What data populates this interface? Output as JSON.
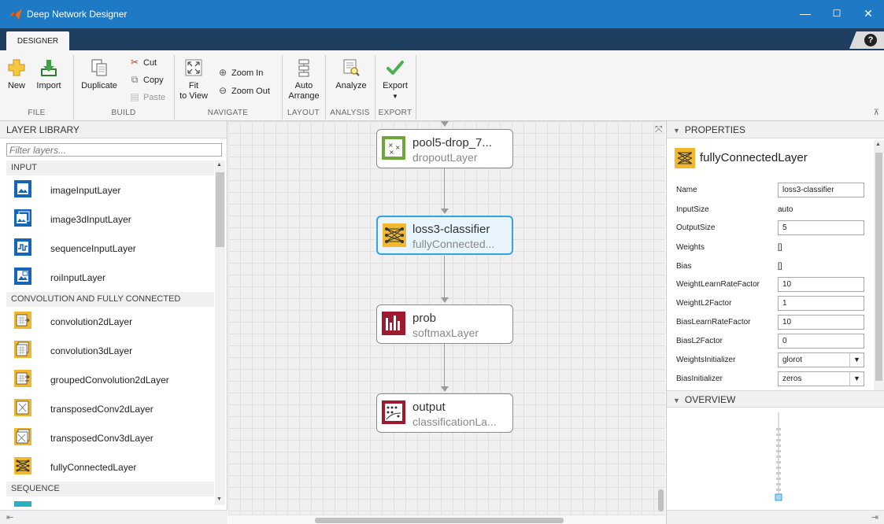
{
  "window": {
    "title": "Deep Network Designer",
    "minimize": "—",
    "maximize": "☐",
    "close": "✕"
  },
  "tabs": {
    "designer": "DESIGNER",
    "help": "?"
  },
  "toolstrip": {
    "new": "New",
    "import": "Import",
    "duplicate": "Duplicate",
    "cut": "Cut",
    "copy": "Copy",
    "paste": "Paste",
    "fit_line1": "Fit",
    "fit_line2": "to View",
    "zoom_in": "Zoom In",
    "zoom_out": "Zoom Out",
    "auto_line1": "Auto",
    "auto_line2": "Arrange",
    "analyze": "Analyze",
    "export": "Export",
    "sections": {
      "file": "FILE",
      "build": "BUILD",
      "navigate": "NAVIGATE",
      "layout": "LAYOUT",
      "analysis": "ANALYSIS",
      "export": "EXPORT"
    }
  },
  "library": {
    "title": "LAYER LIBRARY",
    "filter_placeholder": "Filter layers...",
    "categories": {
      "input": "INPUT",
      "conv": "CONVOLUTION AND FULLY CONNECTED",
      "sequence": "SEQUENCE"
    },
    "input_items": [
      "imageInputLayer",
      "image3dInputLayer",
      "sequenceInputLayer",
      "roiInputLayer"
    ],
    "conv_items": [
      "convolution2dLayer",
      "convolution3dLayer",
      "groupedConvolution2dLayer",
      "transposedConv2dLayer",
      "transposedConv3dLayer",
      "fullyConnectedLayer"
    ],
    "colors": {
      "input": "#1565b8",
      "conv": "#f1b82f"
    }
  },
  "canvas": {
    "nodes": [
      {
        "name": "pool5-drop_7...",
        "type": "dropoutLayer"
      },
      {
        "name": "loss3-classifier",
        "type": "fullyConnected..."
      },
      {
        "name": "prob",
        "type": "softmaxLayer"
      },
      {
        "name": "output",
        "type": "classificationLa..."
      }
    ]
  },
  "properties": {
    "title": "PROPERTIES",
    "layer_type": "fullyConnectedLayer",
    "rows": {
      "name": {
        "label": "Name",
        "value": "loss3-classifier"
      },
      "input_size": {
        "label": "InputSize",
        "value": "auto"
      },
      "output_size": {
        "label": "OutputSize",
        "value": "5"
      },
      "weights": {
        "label": "Weights",
        "value": "[]"
      },
      "bias": {
        "label": "Bias",
        "value": "[]"
      },
      "weight_lr": {
        "label": "WeightLearnRateFactor",
        "value": "10"
      },
      "weight_l2": {
        "label": "WeightL2Factor",
        "value": "1"
      },
      "bias_lr": {
        "label": "BiasLearnRateFactor",
        "value": "10"
      },
      "bias_l2": {
        "label": "BiasL2Factor",
        "value": "0"
      },
      "weights_init": {
        "label": "WeightsInitializer",
        "value": "glorot"
      },
      "bias_init": {
        "label": "BiasInitializer",
        "value": "zeros"
      }
    }
  },
  "overview": {
    "title": "OVERVIEW"
  }
}
